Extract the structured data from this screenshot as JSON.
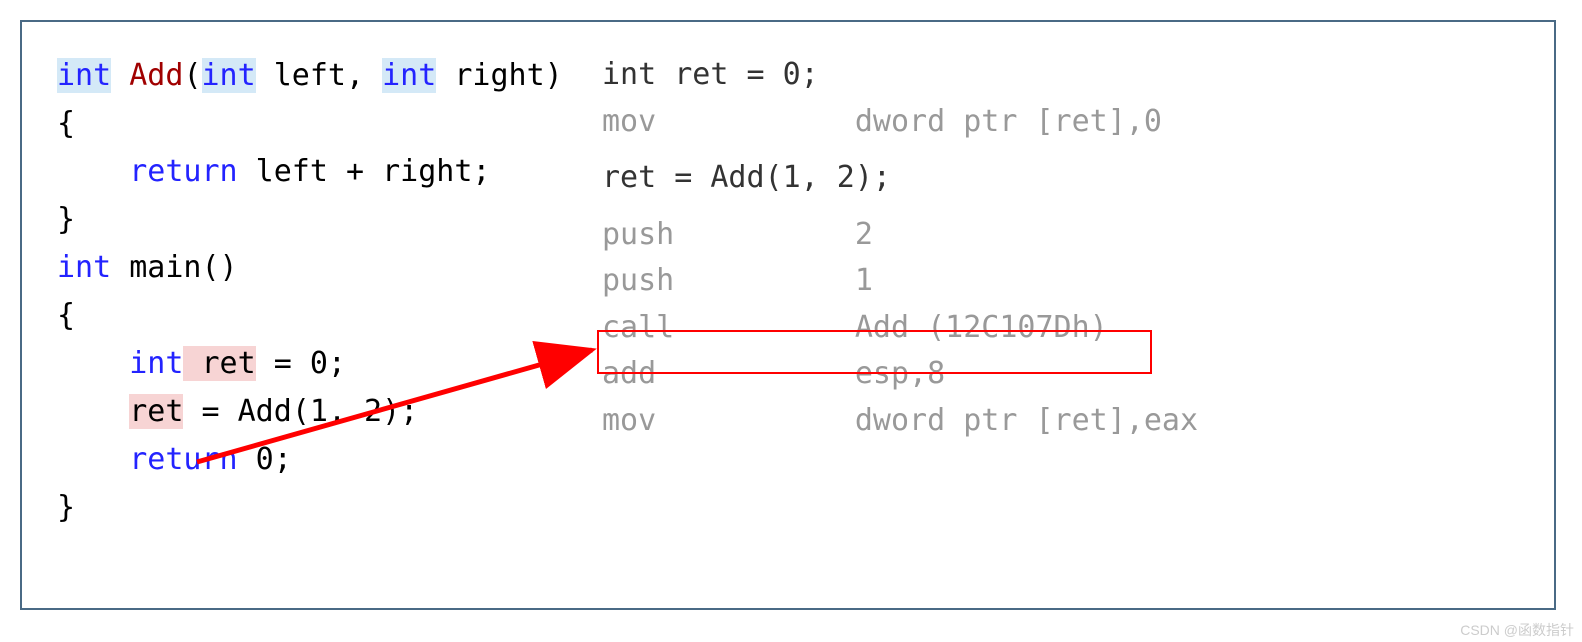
{
  "left": {
    "l1": {
      "kw1": "int",
      "fn": " Add",
      "p1": "(",
      "kw2": "int",
      "t1": " left, ",
      "kw3": "int",
      "t2": " right)"
    },
    "l2": "{",
    "l3": {
      "indent": "    ",
      "kw": "return",
      "t": " left + right;"
    },
    "l4": "}",
    "l5": "",
    "l6": {
      "kw": "int",
      "t": " main()"
    },
    "l7": "{",
    "l8": {
      "indent": "    ",
      "kw": "int",
      "hl": " ret",
      "t": " = 0;"
    },
    "l9": {
      "indent": "    ",
      "hl": "ret",
      "t1": " = Add",
      "fn": "",
      "t2": "(1, 2);"
    },
    "l10": {
      "indent": "    ",
      "kw": "return",
      "t": " 0;"
    },
    "l11": "}"
  },
  "right": {
    "r1": "int ret = 0;",
    "r2": {
      "op": "mov",
      "arg": "dword ptr [ret],0"
    },
    "r3": "ret = Add(1, 2);",
    "r4": {
      "op": "push",
      "arg": "2"
    },
    "r5": {
      "op": "push",
      "arg": "1"
    },
    "r6": {
      "op": "call",
      "arg": "Add (12C107Dh)"
    },
    "r7": {
      "op": "add",
      "arg": "esp,8"
    },
    "r8": {
      "op": "mov",
      "arg": "dword ptr [ret],eax"
    }
  },
  "watermark": "CSDN @函数指针"
}
